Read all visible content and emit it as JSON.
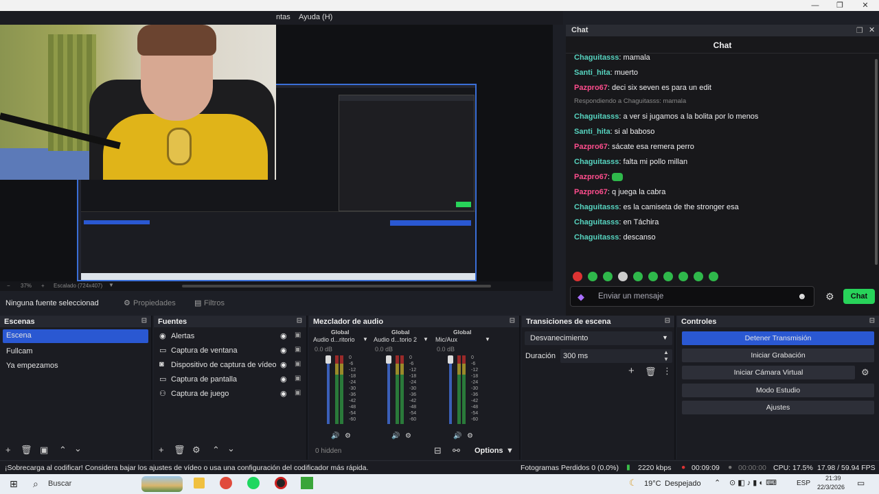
{
  "menu": {
    "windows": "ntas",
    "help": "Ayuda (H)"
  },
  "preview": {
    "zoom_label": "37%",
    "scale_label": "Escalado (724x407)"
  },
  "chat_dock": {
    "dock_title": "Chat",
    "header": "Chat",
    "messages": [
      {
        "user": "Chaguitasss",
        "text": "mamala",
        "color": "#57d4c0"
      },
      {
        "user": "Santi_hita",
        "text": "muerto",
        "color": "#57d4c0"
      },
      {
        "user": "Pazpro67",
        "text": "deci six seven es para un edit",
        "color": "#ff4d8d"
      },
      {
        "user": "",
        "text": "Respondiendo a Chaguitasss: mamala",
        "color": "#888"
      },
      {
        "user": "Chaguitasss",
        "text": "a ver si jugamos a la bolita por lo menos",
        "color": "#57d4c0"
      },
      {
        "user": "Santi_hita",
        "text": "si al baboso",
        "color": "#57d4c0"
      },
      {
        "user": "Pazpro67",
        "text": "sácate esa remera perro",
        "color": "#ff4d8d"
      },
      {
        "user": "Chaguitasss",
        "text": "falta mi pollo millan",
        "color": "#57d4c0"
      },
      {
        "user": "Pazpro67",
        "text": "",
        "color": "#ff4d8d"
      },
      {
        "user": "Pazpro67",
        "text": "q juega la cabra",
        "color": "#ff4d8d"
      },
      {
        "user": "Chaguitasss",
        "text": "es la camiseta de the stronger esa",
        "color": "#57d4c0"
      },
      {
        "user": "Chaguitasss",
        "text": "en Táchira",
        "color": "#57d4c0"
      },
      {
        "user": "Chaguitasss",
        "text": "descanso",
        "color": "#57d4c0"
      }
    ],
    "input_placeholder": "Enviar un mensaje",
    "send_label": "Chat"
  },
  "props": {
    "no_source": "Ninguna fuente seleccionad",
    "properties": "Propiedades",
    "filters": "Filtros"
  },
  "scenes": {
    "title": "Escenas",
    "items": [
      "Escena",
      "Fullcam",
      "Ya empezamos"
    ]
  },
  "sources": {
    "title": "Fuentes",
    "items": [
      "Alertas",
      "Captura de ventana",
      "Dispositivo de captura de vídeo",
      "Captura de pantalla",
      "Captura de juego"
    ]
  },
  "mixer": {
    "title": "Mezclador de audio",
    "channels": [
      {
        "tag": "Global",
        "name": "Audio d...ritorio",
        "db": "0.0 dB"
      },
      {
        "tag": "Global",
        "name": "Audio d...torio 2",
        "db": "0.0 dB"
      },
      {
        "tag": "Global",
        "name": "Mic/Aux",
        "db": "0.0 dB"
      }
    ],
    "scale": [
      "0",
      "-6",
      "-12",
      "-18",
      "-24",
      "-30",
      "-36",
      "-42",
      "-48",
      "-54",
      "-60"
    ],
    "hidden": "0 hidden",
    "options": "Options"
  },
  "transitions": {
    "title": "Transiciones de escena",
    "selected": "Desvanecimiento",
    "duration_label": "Duración",
    "duration_value": "300 ms"
  },
  "controls": {
    "title": "Controles",
    "stop_stream": "Detener Transmisión",
    "start_record": "Iniciar Grabación",
    "virtual_cam": "Iniciar Cámara Virtual",
    "studio_mode": "Modo Estudio",
    "settings": "Ajustes"
  },
  "status": {
    "warning": "¡Sobrecarga al codificar! Considera bajar los ajustes de vídeo o usa una configuración del codificador más rápida.",
    "dropped": "Fotogramas Perdidos 0 (0.0%)",
    "bitrate": "2220 kbps",
    "stream_time": "00:09:09",
    "rec_time": "00:00:00",
    "cpu": "CPU: 17.5%",
    "fps": "17.98 / 59.94 FPS"
  },
  "taskbar": {
    "search": "Buscar",
    "weather_temp": "19°C",
    "weather_text": "Despejado",
    "lang": "ESP",
    "time": "21:39",
    "date": "22/3/2026"
  },
  "colors": {
    "accent": "#2a58d2",
    "twitch_green": "#28d35a",
    "chat_user_teal": "#57d4c0",
    "chat_user_pink": "#ff4d8d"
  }
}
